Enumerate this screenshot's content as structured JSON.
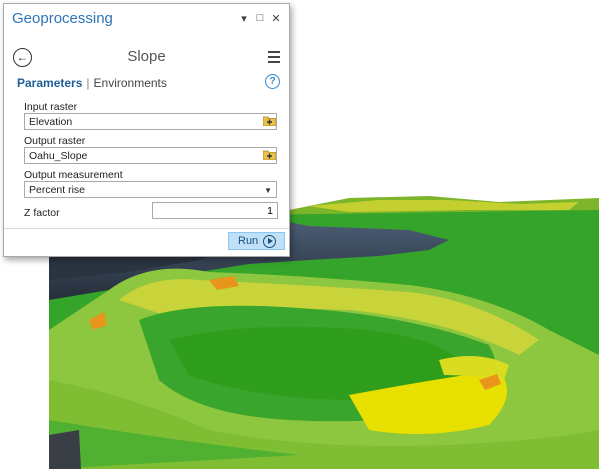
{
  "pane": {
    "title": "Geoprocessing",
    "controls": {
      "pin": "▾",
      "maximize": "□",
      "close": "✕"
    },
    "tool_name": "Slope",
    "tabs": {
      "parameters": "Parameters",
      "environments": "Environments"
    },
    "help": "?"
  },
  "params": {
    "input_raster": {
      "label": "Input raster",
      "value": "Elevation"
    },
    "output_raster": {
      "label": "Output raster",
      "value": "Oahu_Slope"
    },
    "output_measurement": {
      "label": "Output measurement",
      "value": "Percent rise"
    },
    "z_factor": {
      "label": "Z factor",
      "value": "1"
    }
  },
  "run": {
    "label": "Run"
  },
  "colors": {
    "accent": "#2e75b6",
    "terrain_green": "#2f9e1c",
    "terrain_yellow": "#e8e000",
    "water": "#3a4a5e"
  }
}
